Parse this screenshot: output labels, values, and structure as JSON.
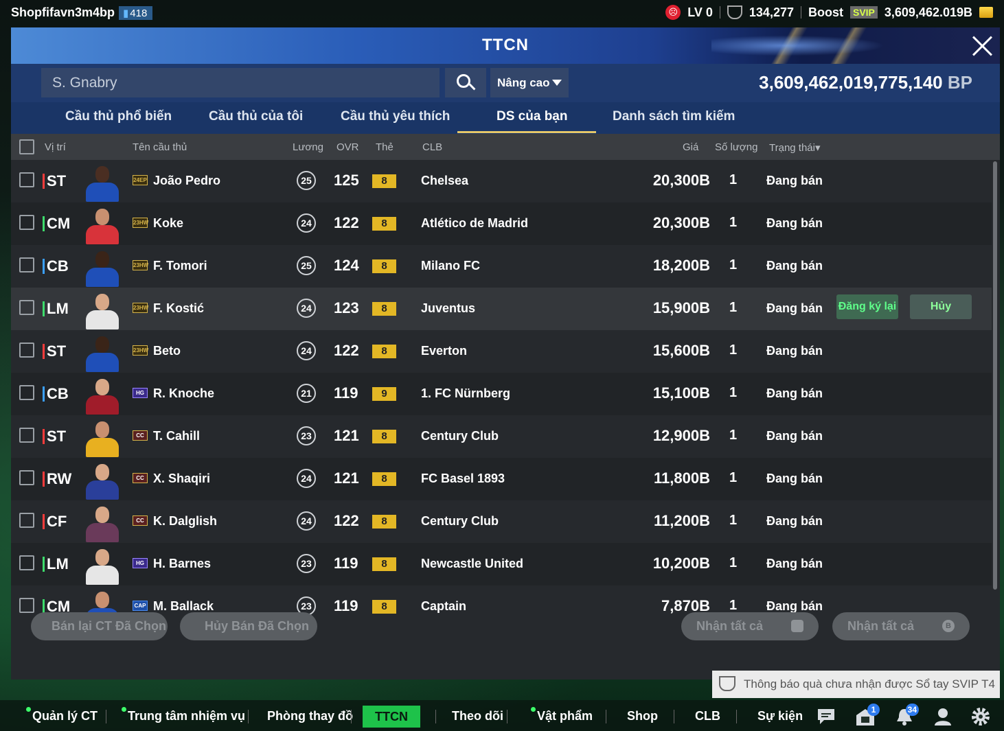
{
  "top_bar": {
    "account_name": "Shopfifavn3m4bp",
    "account_badge": "418",
    "level": "LV 0",
    "trophy_count": "134,277",
    "boost_label": "Boost",
    "svip_label": "SVIP",
    "currency": "3,609,462.019B"
  },
  "window": {
    "title": "TTCN"
  },
  "search": {
    "value": "S. Gnabry",
    "advanced_label": "Nâng cao",
    "bp_amount": "3,609,462,019,775,140",
    "bp_unit": "BP"
  },
  "tabs": [
    {
      "label": "Cầu thủ phổ biến"
    },
    {
      "label": "Cầu thủ của tôi"
    },
    {
      "label": "Cầu thủ yêu thích"
    },
    {
      "label": "DS của bạn"
    },
    {
      "label": "Danh sách tìm kiếm"
    }
  ],
  "active_tab_index": 3,
  "columns": {
    "position": "Vị trí",
    "name": "Tên cầu thủ",
    "salary": "Lương",
    "ovr": "OVR",
    "card": "Thẻ",
    "club": "CLB",
    "price": "Giá",
    "quantity": "Số lượng",
    "status": "Trạng thái▾"
  },
  "rows": [
    {
      "pos": "ST",
      "pos_color": "#ff3b3b",
      "season": "24EP",
      "season_type": "ep",
      "name": "João Pedro",
      "salary": "25",
      "ovr": "125",
      "card": "8",
      "club": "Chelsea",
      "price": "20,300B",
      "qty": "1",
      "status": "Đang bán",
      "kit": "#1f4fb8",
      "skin": "#4a2e22"
    },
    {
      "pos": "CM",
      "pos_color": "#3ddc6b",
      "season": "23HW",
      "season_type": "hw",
      "name": "Koke",
      "salary": "24",
      "ovr": "122",
      "card": "8",
      "club": "Atlético de Madrid",
      "price": "20,300B",
      "qty": "1",
      "status": "Đang bán",
      "kit": "#d8333a",
      "skin": "#c89070"
    },
    {
      "pos": "CB",
      "pos_color": "#3ba0ff",
      "season": "23HW",
      "season_type": "hw",
      "name": "F. Tomori",
      "salary": "25",
      "ovr": "124",
      "card": "8",
      "club": "Milano FC",
      "price": "18,200B",
      "qty": "1",
      "status": "Đang bán",
      "kit": "#1f4fb8",
      "skin": "#3a2418"
    },
    {
      "pos": "LM",
      "pos_color": "#3ddc6b",
      "season": "23HW",
      "season_type": "hw",
      "name": "F. Kostić",
      "salary": "24",
      "ovr": "123",
      "card": "8",
      "club": "Juventus",
      "price": "15,900B",
      "qty": "1",
      "status": "Đang bán",
      "kit": "#e6e6e6",
      "skin": "#d8a888",
      "highlight": true,
      "register_label": "Đăng ký lại",
      "cancel_label": "Hủy"
    },
    {
      "pos": "ST",
      "pos_color": "#ff3b3b",
      "season": "23HW",
      "season_type": "hw",
      "name": "Beto",
      "salary": "24",
      "ovr": "122",
      "card": "8",
      "club": "Everton",
      "price": "15,600B",
      "qty": "1",
      "status": "Đang bán",
      "kit": "#1f4fb8",
      "skin": "#3a2418"
    },
    {
      "pos": "CB",
      "pos_color": "#3ba0ff",
      "season": "HG",
      "season_type": "hg",
      "name": "R. Knoche",
      "salary": "21",
      "ovr": "119",
      "card": "9",
      "club": "1. FC Nürnberg",
      "price": "15,100B",
      "qty": "1",
      "status": "Đang bán",
      "kit": "#a01c2a",
      "skin": "#d8a888"
    },
    {
      "pos": "ST",
      "pos_color": "#ff3b3b",
      "season": "CC",
      "season_type": "cc",
      "name": "T. Cahill",
      "salary": "23",
      "ovr": "121",
      "card": "8",
      "club": "Century Club",
      "price": "12,900B",
      "qty": "1",
      "status": "Đang bán",
      "kit": "#e8b020",
      "skin": "#c89070"
    },
    {
      "pos": "RW",
      "pos_color": "#ff3b3b",
      "season": "CC",
      "season_type": "cc",
      "name": "X. Shaqiri",
      "salary": "24",
      "ovr": "121",
      "card": "8",
      "club": "FC Basel 1893",
      "price": "11,800B",
      "qty": "1",
      "status": "Đang bán",
      "kit": "#2a3f9a",
      "skin": "#d8a888"
    },
    {
      "pos": "CF",
      "pos_color": "#ff3b3b",
      "season": "CC",
      "season_type": "cc",
      "name": "K. Dalglish",
      "salary": "24",
      "ovr": "122",
      "card": "8",
      "club": "Century Club",
      "price": "11,200B",
      "qty": "1",
      "status": "Đang bán",
      "kit": "#6a3a5a",
      "skin": "#d8a888"
    },
    {
      "pos": "LM",
      "pos_color": "#3ddc6b",
      "season": "HG",
      "season_type": "hg",
      "name": "H. Barnes",
      "salary": "23",
      "ovr": "119",
      "card": "8",
      "club": "Newcastle United",
      "price": "10,200B",
      "qty": "1",
      "status": "Đang bán",
      "kit": "#e6e6e6",
      "skin": "#d8a888"
    },
    {
      "pos": "CM",
      "pos_color": "#3ddc6b",
      "season": "CAP",
      "season_type": "cap",
      "name": "M. Ballack",
      "salary": "23",
      "ovr": "119",
      "card": "8",
      "club": "Captain",
      "price": "7,870B",
      "qty": "1",
      "status": "Đang bán",
      "kit": "#1f4fb8",
      "skin": "#c89070"
    }
  ],
  "footer_buttons": {
    "resell_selected": "Bán lại CT Đã Chọn",
    "cancel_selected": "Hủy Bán Đã Chọn",
    "claim_all_1": "Nhận tất cả",
    "claim_all_2": "Nhận tất cả",
    "claim_icon_2_text": "B"
  },
  "notice": "Thông báo quà chưa nhận được Sổ tay SVIP T4",
  "bottom_nav": {
    "items": [
      {
        "label": "Quản lý CT",
        "dot": true
      },
      {
        "label": "Trung tâm nhiệm vụ",
        "dot": true
      },
      {
        "label": "Phòng thay đồ",
        "dot": false
      },
      {
        "label": "TTCN",
        "dot": false,
        "active": true
      },
      {
        "label": "Theo dõi",
        "dot": false
      },
      {
        "label": "Vật phẩm",
        "dot": true
      },
      {
        "label": "Shop",
        "dot": false
      },
      {
        "label": "CLB",
        "dot": false
      },
      {
        "label": "Sự kiện",
        "dot": false
      }
    ],
    "mail_badge": "1",
    "bell_badge": "34"
  }
}
